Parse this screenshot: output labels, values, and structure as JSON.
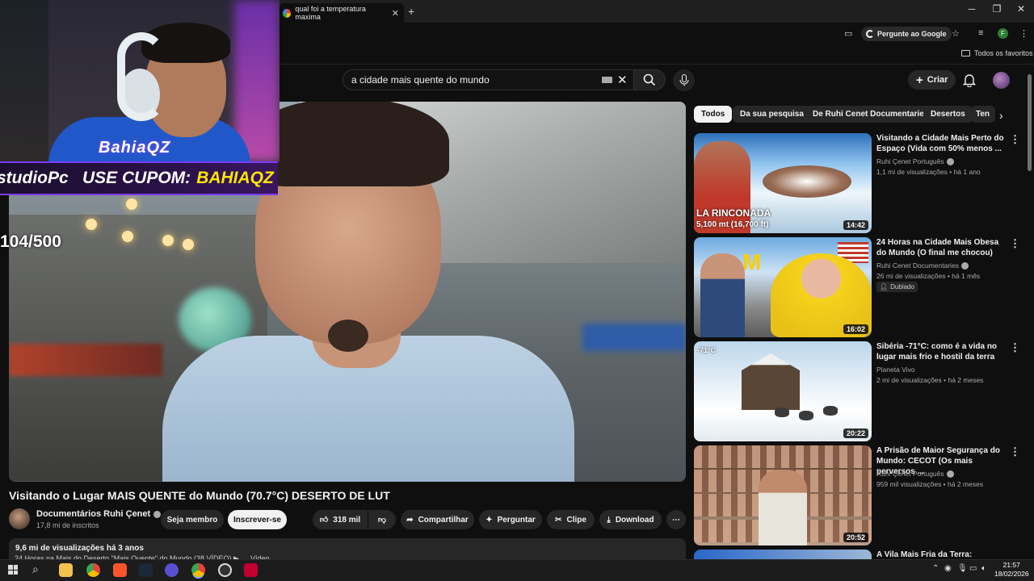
{
  "browser": {
    "tab_title": "qual foi a temperatura maxima",
    "ask_google": "Pergunte ao Google",
    "bookmarks_folder": "Todos os favoritos"
  },
  "stream_overlay": {
    "brand": "BahiaQZ",
    "studio": "studioPc",
    "coupon_label": "USE CUPOM:",
    "coupon_code": "BAHIAQZ",
    "counter": "104/500"
  },
  "youtube": {
    "search_value": "a cidade mais quente do mundo",
    "create_label": "Criar",
    "video": {
      "title": "Visitando o Lugar MAIS QUENTE do Mundo (70.7°C) DESERTO DE LUT",
      "channel": "Documentários Ruhi Çenet",
      "subscribers": "17,8 mi de inscritos",
      "member_label": "Seja membro",
      "subscribe_label": "Inscrever-se",
      "likes": "318 mil",
      "share_label": "Compartilhar",
      "ask_label": "Perguntar",
      "clip_label": "Clipe",
      "download_label": "Download",
      "views_date": "9,6 mi de visualizações  há 3 anos",
      "desc_line": "24 Horas na Mais do Deserto \"Mais Quente\" do Mundo (38 VÍDEO) ▶ … Vídeo"
    },
    "chips": [
      "Todos",
      "Da sua pesquisa",
      "De Ruhi Cenet Documentaries",
      "Desertos",
      "Ten"
    ],
    "recommendations": [
      {
        "title": "Visitando a Cidade Mais Perto do Espaço (Vida com 50% menos ...",
        "channel": "Ruhi Çenet Português",
        "meta": "1,1 mi de visualizações • há 1 ano",
        "duration": "14:42",
        "thumb_text": "LA RINCONADA\n5,100 mt (16,700 ft)"
      },
      {
        "title": "24 Horas na Cidade Mais Obesa do Mundo (O final me chocou)",
        "channel": "Ruhi Cenet Documentaries",
        "meta": "26 mi de visualizações • há 1 mês",
        "badge": "Dublado",
        "duration": "16:02"
      },
      {
        "title": "Sibéria -71°C: como é a vida no lugar mais frio e hostil da terra",
        "channel": "Planeta Vivo",
        "meta": "2 mi de visualizações • há 2 meses",
        "duration": "20:22",
        "thumb_text": "-71°C"
      },
      {
        "title": "A Prisão de Maior Segurança do Mundo: CECOT (Os mais perversos ...",
        "channel": "Ruhi Çenet Português",
        "meta": "959 mil visualizações • há 2 meses",
        "duration": "20:52"
      },
      {
        "title": "A Vila Mais Fria da Terra: Oymyakon"
      }
    ]
  },
  "taskbar": {
    "time": "21:57",
    "date": "18/02/2026"
  }
}
